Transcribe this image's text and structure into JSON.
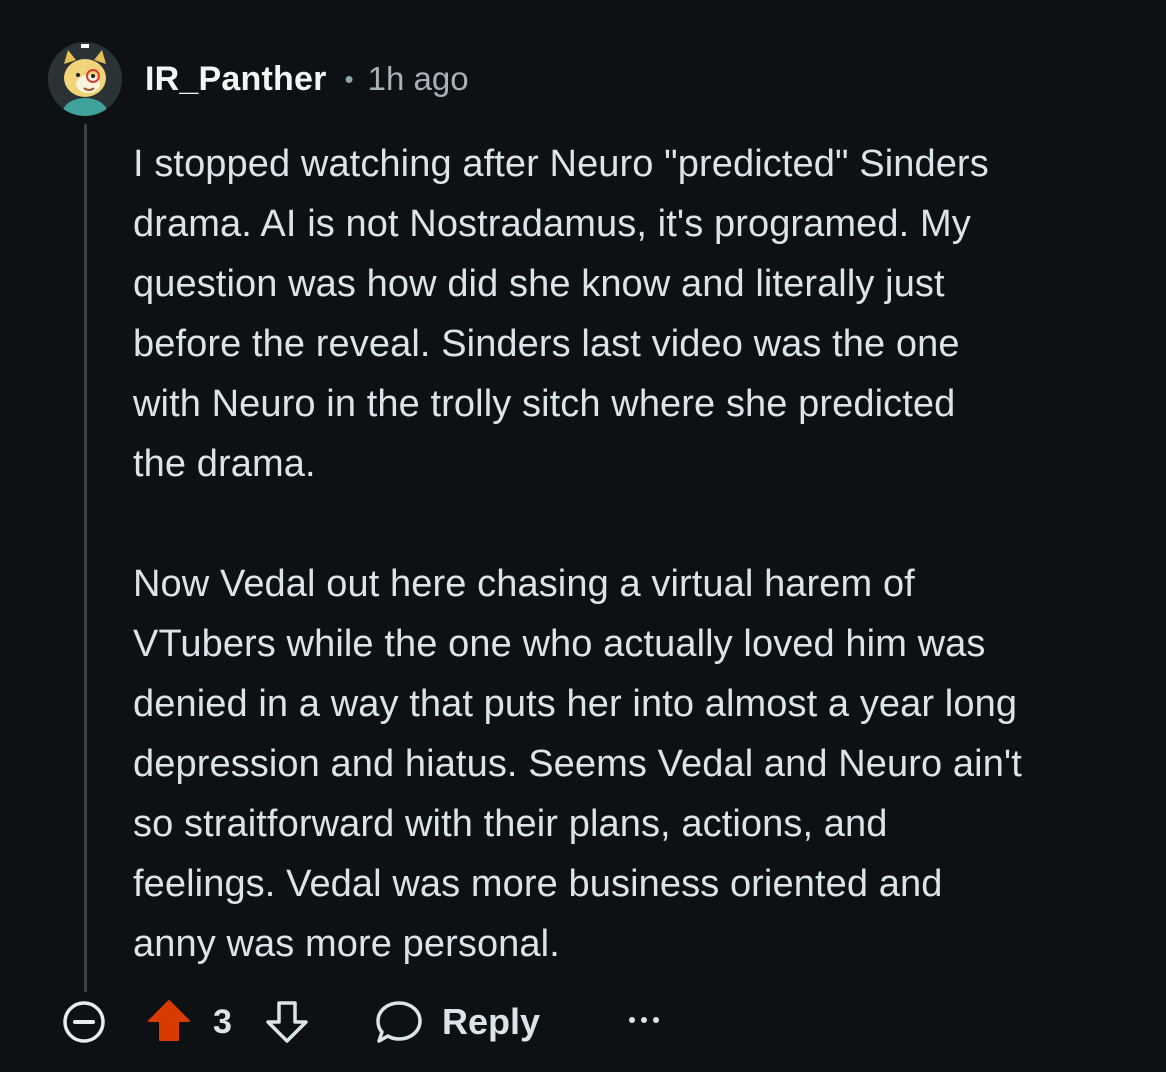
{
  "comment": {
    "username": "IR_Panther",
    "separator": "•",
    "time": "1h ago",
    "paragraphs": [
      [
        "I stopped watching after Neuro \"predicted\" Sinders",
        "drama. AI is not Nostradamus, it's programed. My",
        "question was how did she know and literally just",
        "before the reveal. Sinders last video was the one",
        "with Neuro in the trolly sitch where she predicted",
        "the drama."
      ],
      [
        "Now Vedal out here chasing a virtual harem of",
        "VTubers while the one who actually loved him was",
        "denied in a way that puts her into almost a year long",
        "depression and hiatus. Seems Vedal and Neuro ain't",
        "so straitforward with their plans, actions, and",
        "feelings. Vedal was more business oriented and",
        "anny was more personal."
      ]
    ]
  },
  "actions": {
    "score": "3",
    "reply_label": "Reply",
    "upvote_color": "#d93a00",
    "icons": [
      "collapse-icon",
      "upvote-arrow-icon",
      "downvote-arrow-icon",
      "reply-bubble-icon",
      "more-options-icon"
    ]
  }
}
